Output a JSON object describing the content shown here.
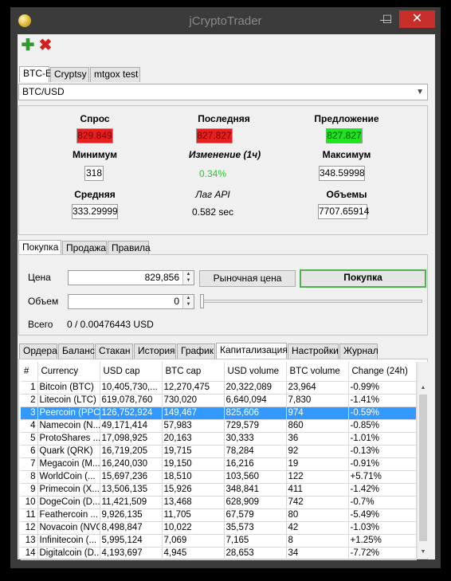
{
  "window": {
    "title": "jCryptoTrader",
    "min_glyph": "—",
    "max_glyph": "☐",
    "close_glyph": "✕"
  },
  "toolbar": {
    "add_glyph": "✚",
    "delete_glyph": "✖"
  },
  "exchange_tabs": [
    "BTC-E",
    "Cryptsy",
    "mtgox test"
  ],
  "pair": {
    "selected": "BTC/USD"
  },
  "ticker": {
    "bid_label": "Спрос",
    "bid": "829.849",
    "last_label": "Последняя",
    "last": "827.827",
    "ask_label": "Предложение",
    "ask": "827.827",
    "min_label": "Минимум",
    "min": "318",
    "change_label": "Изменение (1ч)",
    "change": "0.34%",
    "max_label": "Максимум",
    "max": "348.59998",
    "avg_label": "Средняя",
    "avg": "333.29999",
    "lag_label": "Лаг API",
    "lag": "0.582 sec",
    "volume_label": "Объемы",
    "volume": "7707.65914",
    "colors": {
      "red": "#e52020",
      "green": "#22e022",
      "change_text": "#22cc22"
    }
  },
  "trade_tabs": [
    "Покупка",
    "Продажа",
    "Правила"
  ],
  "trade": {
    "price_label": "Цена",
    "price_value": "829,856",
    "market_price_button": "Рыночная цена",
    "buy_button": "Покупка",
    "volume_label": "Объем",
    "volume_value": "0",
    "total_label": "Всего",
    "total_value": "0 / 0.00476443 USD"
  },
  "data_tabs": [
    "Ордера",
    "Баланс",
    "Стакан",
    "История",
    "График",
    "Капитализация",
    "Настройки",
    "Журнал"
  ],
  "cap_table": {
    "headers": [
      "#",
      "Currency",
      "USD cap",
      "BTC cap",
      "USD volume",
      "BTC volume",
      "Change (24h)"
    ],
    "selected_row": 2,
    "rows": [
      [
        "1",
        "Bitcoin (BTC)",
        "10,405,730,...",
        "12,270,475",
        "20,322,089",
        "23,964",
        "-0.99%"
      ],
      [
        "2",
        "Litecoin (LTC)",
        "619,078,760",
        "730,020",
        "6,640,094",
        "7,830",
        "-1.41%"
      ],
      [
        "3",
        "Peercoin (PPC)",
        "126,752,924",
        "149,467",
        "825,606",
        "974",
        "-0.59%"
      ],
      [
        "4",
        "Namecoin (N...",
        "49,171,414",
        "57,983",
        "729,579",
        "860",
        "-0.85%"
      ],
      [
        "5",
        "ProtoShares ...",
        "17,098,925",
        "20,163",
        "30,333",
        "36",
        "-1.01%"
      ],
      [
        "6",
        "Quark (QRK)",
        "16,719,205",
        "19,715",
        "78,284",
        "92",
        "-0.13%"
      ],
      [
        "7",
        "Megacoin (M...",
        "16,240,030",
        "19,150",
        "16,216",
        "19",
        "-0.91%"
      ],
      [
        "8",
        "WorldCoin (...",
        "15,697,236",
        "18,510",
        "103,560",
        "122",
        "+5.71%"
      ],
      [
        "9",
        "Primecoin (X...",
        "13,506,135",
        "15,926",
        "348,841",
        "411",
        "-1.42%"
      ],
      [
        "10",
        "DogeCoin (D...",
        "11,421,509",
        "13,468",
        "628,909",
        "742",
        "-0.7%"
      ],
      [
        "11",
        "Feathercoin ...",
        "9,926,135",
        "11,705",
        "67,579",
        "80",
        "-5.49%"
      ],
      [
        "12",
        "Novacoin (NVC)",
        "8,498,847",
        "10,022",
        "35,573",
        "42",
        "-1.03%"
      ],
      [
        "13",
        "Infinitecoin (...",
        "5,995,124",
        "7,069",
        "7,165",
        "8",
        "+1.25%"
      ],
      [
        "14",
        "Digitalcoin (D...",
        "4,193,697",
        "4,945",
        "28,653",
        "34",
        "-7.72%"
      ]
    ]
  }
}
